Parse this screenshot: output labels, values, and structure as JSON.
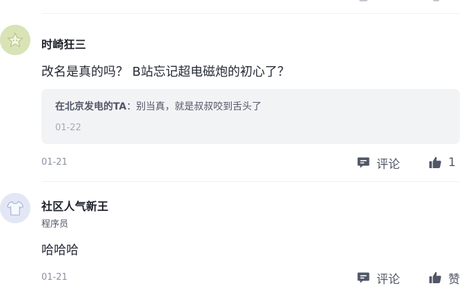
{
  "comments": [
    {
      "username": "时崎狂三",
      "avatar_icon": "star-avatar-icon",
      "content": "改名是真的吗？ B站忘记超电磁炮的初心了？",
      "reply": {
        "author": "在北京发电的TA",
        "separator": "：",
        "text": "别当真，就是叔叔咬到舌头了",
        "date": "01-22"
      },
      "date": "01-21",
      "comment_label": "评论",
      "like_label": "1"
    },
    {
      "username": "社区人气新王",
      "avatar_icon": "tshirt-avatar-icon",
      "title": "程序员",
      "content": "哈哈哈",
      "date": "01-21",
      "comment_label": "评论",
      "like_label": "赞"
    }
  ],
  "colors": {
    "text_primary": "#252933",
    "text_secondary": "#515767",
    "text_muted": "#8a919f",
    "reply_bg": "#f2f3f5",
    "divider": "#eef0f3",
    "icon": "#515767"
  }
}
